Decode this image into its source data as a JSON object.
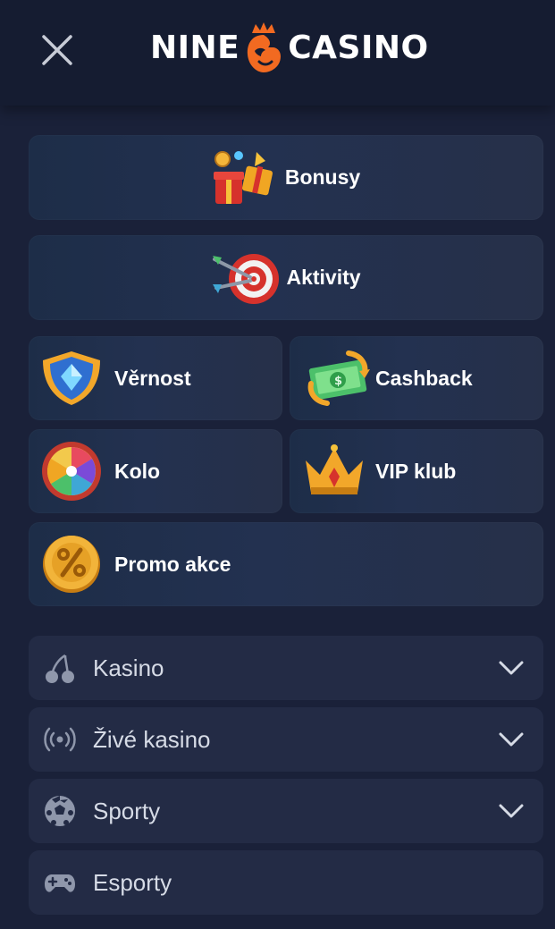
{
  "header": {
    "logo_left": "NINE",
    "logo_right": "CASINO",
    "close_icon": "close-icon",
    "brand_color": "#f26a21"
  },
  "promos": [
    {
      "label": "Bonusy",
      "icon": "gift-boxes-icon"
    },
    {
      "label": "Aktivity",
      "icon": "dart-target-icon"
    },
    {
      "label": "Věrnost",
      "icon": "shield-gem-icon"
    },
    {
      "label": "Cashback",
      "icon": "cashback-money-icon"
    },
    {
      "label": "Kolo",
      "icon": "fortune-wheel-icon"
    },
    {
      "label": "VIP klub",
      "icon": "crown-icon"
    },
    {
      "label": "Promo akce",
      "icon": "percent-coin-icon"
    }
  ],
  "nav": [
    {
      "label": "Kasino",
      "icon": "cherries-icon",
      "expandable": true
    },
    {
      "label": "Živé kasino",
      "icon": "live-broadcast-icon",
      "expandable": true
    },
    {
      "label": "Sporty",
      "icon": "soccer-ball-icon",
      "expandable": true
    },
    {
      "label": "Esporty",
      "icon": "gamepad-icon",
      "expandable": false
    }
  ]
}
